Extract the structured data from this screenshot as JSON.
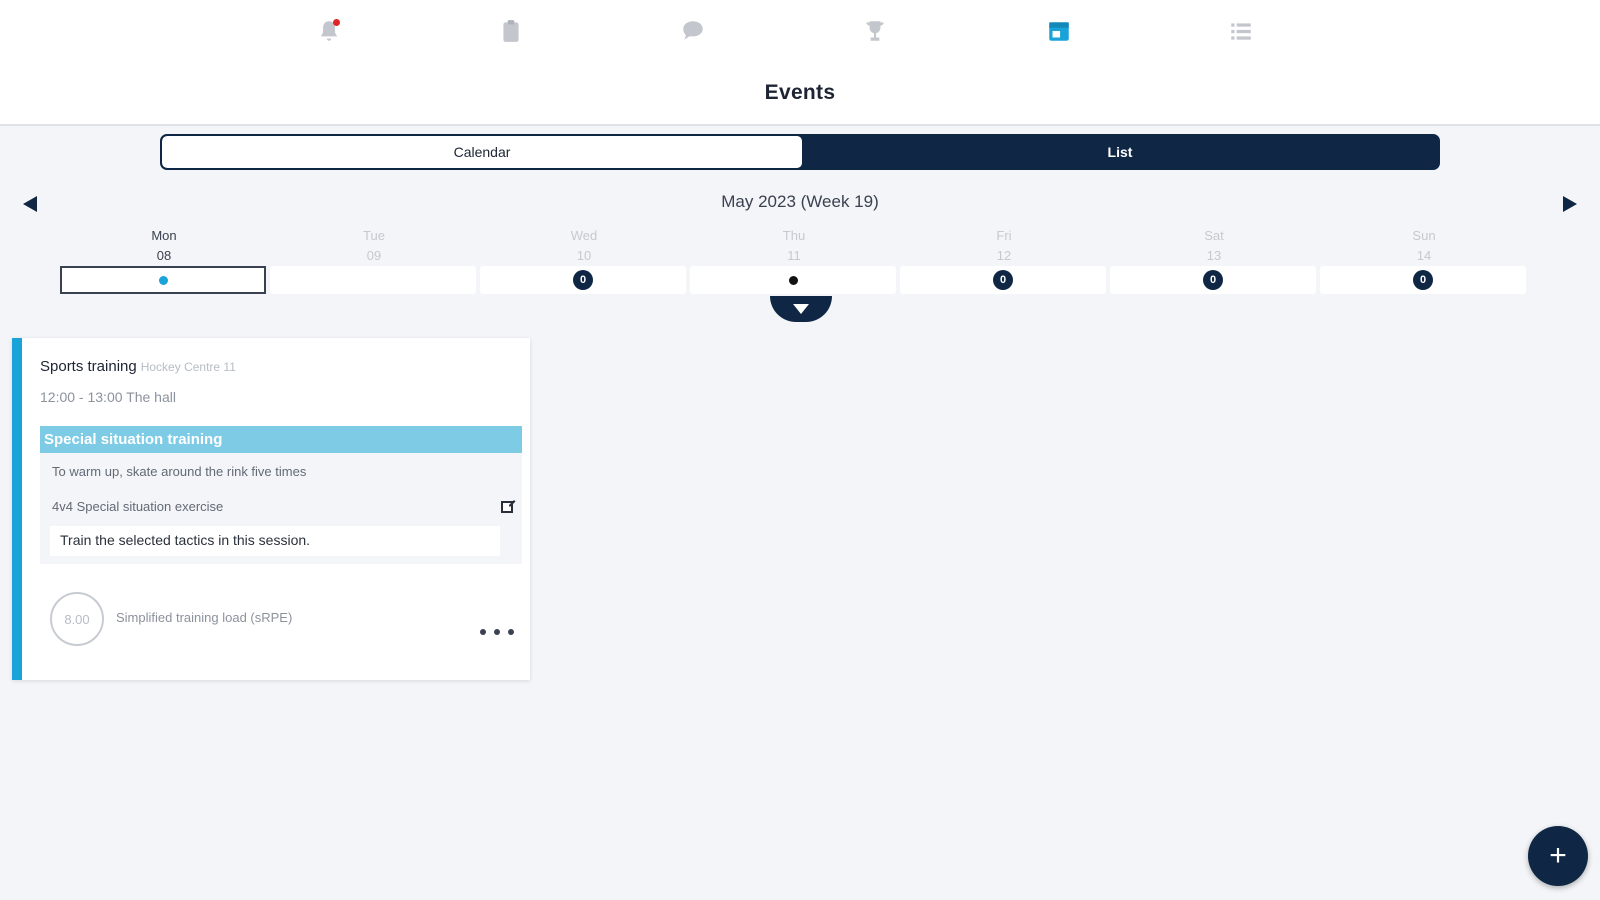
{
  "nav": {
    "icons": [
      "bell-icon",
      "clipboard-icon",
      "chat-icon",
      "trophy-icon",
      "calendar-icon",
      "list-icon"
    ],
    "active": "calendar-icon",
    "has_notification": true
  },
  "colors": {
    "accent": "#1aa3d9",
    "navy": "#0f2745",
    "notification": "#e02424"
  },
  "header": {
    "title": "Events"
  },
  "view_toggle": {
    "calendar_label": "Calendar",
    "list_label": "List",
    "selected": "List"
  },
  "week": {
    "title": "May 2023 (Week 19)",
    "days": [
      {
        "name": "Mon",
        "num": "08",
        "marker": "dot-blue",
        "selected": true
      },
      {
        "name": "Tue",
        "num": "09",
        "marker": "none",
        "selected": false
      },
      {
        "name": "Wed",
        "num": "10",
        "marker": "badge",
        "badge": "0",
        "selected": false
      },
      {
        "name": "Thu",
        "num": "11",
        "marker": "dot-black",
        "selected": false
      },
      {
        "name": "Fri",
        "num": "12",
        "marker": "badge",
        "badge": "0",
        "selected": false
      },
      {
        "name": "Sat",
        "num": "13",
        "marker": "badge",
        "badge": "0",
        "selected": false
      },
      {
        "name": "Sun",
        "num": "14",
        "marker": "badge",
        "badge": "0",
        "selected": false
      }
    ]
  },
  "event": {
    "title": "Sports training",
    "location": "Hockey Centre 11",
    "time": "12:00 - 13:00 The hall",
    "plan_title": "Special situation training",
    "plan_items": [
      "To warm up, skate around the rink five times",
      "4v4 Special situation exercise"
    ],
    "note": "Train the selected tactics in this session.",
    "load_value": "8.00",
    "load_label": "Simplified training load (sRPE)"
  },
  "fab": {
    "label": "+"
  }
}
